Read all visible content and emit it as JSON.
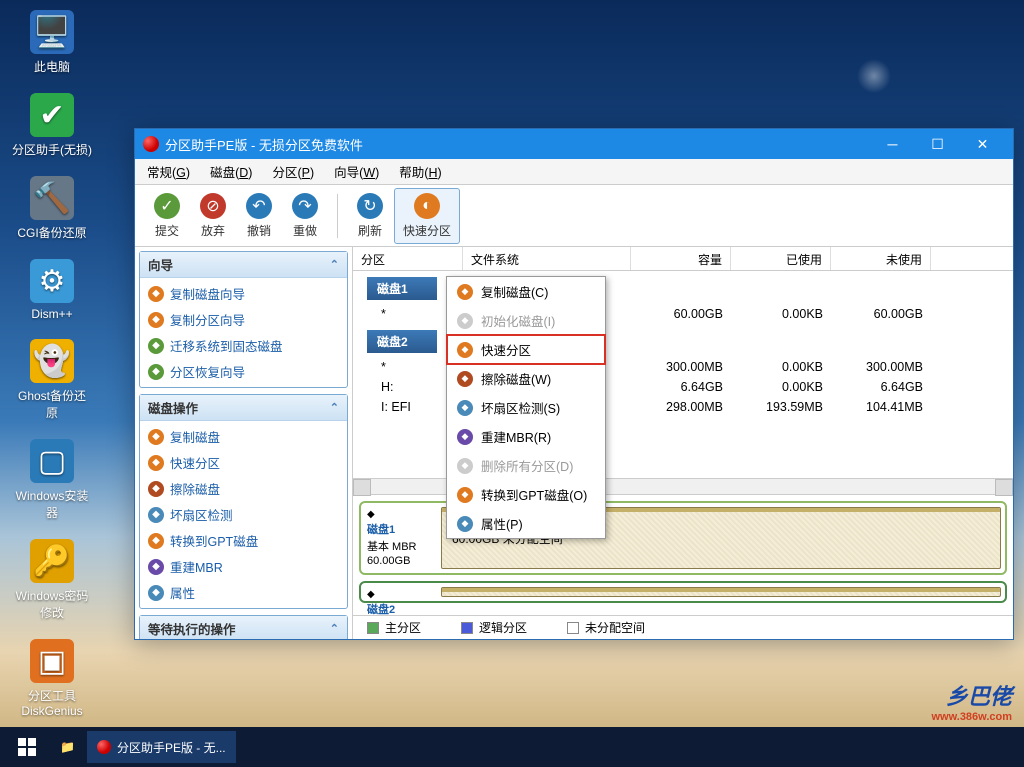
{
  "desktop_icons": [
    {
      "name": "此电脑",
      "icon": "🖥️",
      "bg": "#2a6ab8"
    },
    {
      "name": "分区助手(无损)",
      "icon": "✔",
      "bg": "#2aa84a"
    },
    {
      "name": "CGI备份还原",
      "icon": "🔨",
      "bg": "#678"
    },
    {
      "name": "Dism++",
      "icon": "⚙",
      "bg": "#3a9ad8"
    },
    {
      "name": "Ghost备份还原",
      "icon": "👻",
      "bg": "#f0b000"
    },
    {
      "name": "Windows安装器",
      "icon": "▢",
      "bg": "#2a7ab8"
    },
    {
      "name": "Windows密码修改",
      "icon": "🔑",
      "bg": "#e0a000"
    },
    {
      "name": "分区工具DiskGenius",
      "icon": "▣",
      "bg": "#e07020"
    }
  ],
  "window": {
    "title": "分区助手PE版 - 无损分区免费软件",
    "menu": [
      "常规(G)",
      "磁盘(D)",
      "分区(P)",
      "向导(W)",
      "帮助(H)"
    ],
    "toolbar": [
      {
        "label": "提交",
        "icon": "✓",
        "bg": "#5a9a3a"
      },
      {
        "label": "放弃",
        "icon": "⊘",
        "bg": "#c0392b"
      },
      {
        "label": "撤销",
        "icon": "↶",
        "bg": "#2a7ab8"
      },
      {
        "label": "重做",
        "icon": "↷",
        "bg": "#2a7ab8"
      },
      {
        "sep": true
      },
      {
        "label": "刷新",
        "icon": "↻",
        "bg": "#2a7ab8",
        "boxed": false
      },
      {
        "label": "快速分区",
        "icon": "◐",
        "bg": "#e07a20",
        "boxed": true
      }
    ],
    "columns": [
      {
        "label": "分区",
        "w": 110,
        "align": "left"
      },
      {
        "label": "文件系统",
        "w": 168,
        "align": "left"
      },
      {
        "label": "容量",
        "w": 100
      },
      {
        "label": "已使用",
        "w": 100
      },
      {
        "label": "未使用",
        "w": 100
      }
    ],
    "disks": [
      {
        "name": "磁盘1",
        "rows": [
          {
            "part": "*",
            "fs": "",
            "cap": "60.00GB",
            "used": "0.00KB",
            "free": "60.00GB"
          }
        ]
      },
      {
        "name": "磁盘2",
        "rows": [
          {
            "part": "*",
            "fs": "",
            "cap": "300.00MB",
            "used": "0.00KB",
            "free": "300.00MB"
          },
          {
            "part": "H:",
            "fs": "",
            "cap": "6.64GB",
            "used": "0.00KB",
            "free": "6.64GB"
          },
          {
            "part": "I: EFI",
            "fs": "",
            "cap": "298.00MB",
            "used": "193.59MB",
            "free": "104.41MB"
          }
        ]
      }
    ],
    "disk_panels": [
      {
        "name": "磁盘1",
        "sub1": "基本 MBR",
        "sub2": "60.00GB",
        "seg": "60.00GB 未分配空间"
      },
      {
        "name": "磁盘2",
        "sub1": "",
        "sub2": "",
        "seg": ""
      }
    ],
    "legend": [
      {
        "label": "主分区",
        "color": "#5aa85a"
      },
      {
        "label": "逻辑分区",
        "color": "#4a5ad8"
      },
      {
        "label": "未分配空间",
        "color": "#ffffff"
      }
    ],
    "sidebar": {
      "panel1_title": "向导",
      "panel1": [
        {
          "label": "复制磁盘向导",
          "bg": "#e07a20"
        },
        {
          "label": "复制分区向导",
          "bg": "#e07a20"
        },
        {
          "label": "迁移系统到固态磁盘",
          "bg": "#5a9a3a"
        },
        {
          "label": "分区恢复向导",
          "bg": "#5a9a3a"
        }
      ],
      "panel2_title": "磁盘操作",
      "panel2": [
        {
          "label": "复制磁盘",
          "bg": "#e07a20"
        },
        {
          "label": "快速分区",
          "bg": "#e07a20"
        },
        {
          "label": "擦除磁盘",
          "bg": "#b04a20"
        },
        {
          "label": "坏扇区检测",
          "bg": "#4a8ab8"
        },
        {
          "label": "转换到GPT磁盘",
          "bg": "#e07a20"
        },
        {
          "label": "重建MBR",
          "bg": "#6a4aa8"
        },
        {
          "label": "属性",
          "bg": "#4a8ab8"
        }
      ],
      "panel3_title": "等待执行的操作"
    },
    "context_menu": [
      {
        "label": "复制磁盘(C)",
        "bg": "#e07a20"
      },
      {
        "label": "初始化磁盘(I)",
        "disabled": true
      },
      {
        "label": "快速分区",
        "bg": "#e07a20",
        "hl": true
      },
      {
        "label": "擦除磁盘(W)",
        "bg": "#b04a20"
      },
      {
        "label": "坏扇区检测(S)",
        "bg": "#4a8ab8"
      },
      {
        "label": "重建MBR(R)",
        "bg": "#6a4aa8"
      },
      {
        "label": "删除所有分区(D)",
        "disabled": true
      },
      {
        "label": "转换到GPT磁盘(O)",
        "bg": "#e07a20"
      },
      {
        "label": "属性(P)",
        "bg": "#4a8ab8"
      }
    ]
  },
  "taskbar": {
    "task": "分区助手PE版 - 无..."
  },
  "watermark": {
    "l1": "乡巴佬",
    "l2": "www.386w.com"
  }
}
